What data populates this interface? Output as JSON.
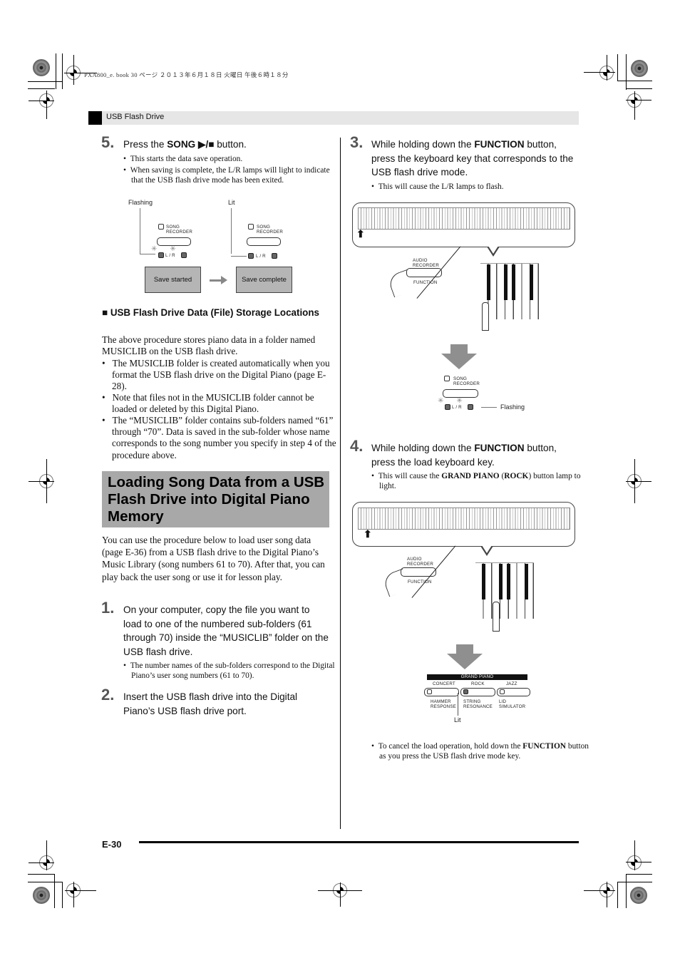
{
  "print_marks": {
    "job_info": "PXA800_e. book  30 ページ  ２０１３年６月１８日  火曜日  午後６時１８分"
  },
  "header": {
    "section_label": "USB Flash Drive"
  },
  "left_column": {
    "step5": {
      "number": "5.",
      "text_prefix": "Press the ",
      "text_bold": "SONG ▶/■",
      "text_suffix": " button.",
      "bullets": [
        "This starts the data save operation.",
        "When saving is complete, the L/R lamps will light to indicate that the USB flash drive mode has been exited."
      ],
      "figure": {
        "label_flashing": "Flashing",
        "label_lit": "Lit",
        "song_recorder_label_1": "SONG",
        "song_recorder_label_2": "RECORDER",
        "lr_label_flashing": "L / R",
        "lr_label_lit": "L / R",
        "box_save_started": "Save started",
        "box_save_complete": "Save complete"
      }
    },
    "storage": {
      "heading": "USB Flash Drive Data (File) Storage Locations",
      "intro": "The above procedure stores piano data in a folder named MUSICLIB on the USB flash drive.",
      "bullets": [
        "The MUSICLIB folder is created automatically when you format the USB flash drive on the Digital Piano (page E-28).",
        "Note that files not in the MUSICLIB folder cannot be loaded or deleted by this Digital Piano.",
        "The “MUSICLIB” folder contains sub-folders named “61” through “70”. Data is saved in the sub-folder whose name corresponds to the song number you specify in step 4 of the procedure above."
      ]
    },
    "section": {
      "title": "Loading Song Data from a USB Flash Drive into Digital Piano Memory",
      "intro": "You can use the procedure below to load user song data (page E-36) from a USB flash drive to the Digital Piano’s Music Library (song numbers 61 to 70). After that, you can play back the user song or use it for lesson play."
    },
    "step1": {
      "number": "1.",
      "text": "On your computer, copy the file you want to load to one of the numbered sub-folders (61 through 70) inside the “MUSICLIB” folder on the USB flash drive.",
      "bullets": [
        "The number names of the sub-folders correspond to the Digital Piano’s user song numbers (61 to 70)."
      ]
    },
    "step2": {
      "number": "2.",
      "text": "Insert the USB flash drive into the Digital Piano’s USB flash drive port."
    }
  },
  "right_column": {
    "step3": {
      "number": "3.",
      "text_prefix": "While holding down the ",
      "text_bold": "FUNCTION",
      "text_suffix": " button, press the keyboard key that corresponds to the USB flash drive mode.",
      "bullets": [
        "This will cause the L/R lamps to flash."
      ],
      "figure": {
        "audio_label_1": "AUDIO",
        "audio_label_2": "RECORDER",
        "function_label": "FUNCTION",
        "song_recorder_label_1": "SONG",
        "song_recorder_label_2": "RECORDER",
        "lr_label": "L / R",
        "label_flashing": "Flashing"
      }
    },
    "step4": {
      "number": "4.",
      "text_prefix": "While holding down the ",
      "text_bold": "FUNCTION",
      "text_suffix": " button, press the load keyboard key.",
      "bullet_prefix": "This will cause the ",
      "bullet_bold1": "GRAND PIANO",
      "bullet_mid": " (",
      "bullet_bold2": "ROCK",
      "bullet_suffix": ") button lamp to light.",
      "figure": {
        "audio_label_1": "AUDIO",
        "audio_label_2": "RECORDER",
        "function_label": "FUNCTION",
        "grand_piano_label": "GRAND PIANO",
        "tone_concert": "CONCERT",
        "tone_rock": "ROCK",
        "tone_jazz": "JAZZ",
        "sub_hammer_1": "HAMMER",
        "sub_hammer_2": "RESPONSE",
        "sub_string_1": "STRING",
        "sub_string_2": "RESONANCE",
        "sub_lid_1": "LID",
        "sub_lid_2": "SIMULATOR",
        "label_lit": "Lit"
      }
    },
    "cancel_note": {
      "prefix": "To cancel the load operation, hold down the ",
      "bold": "FUNCTION",
      "suffix": " button as you press the USB flash drive mode key."
    }
  },
  "footer": {
    "page_number": "E-30"
  }
}
